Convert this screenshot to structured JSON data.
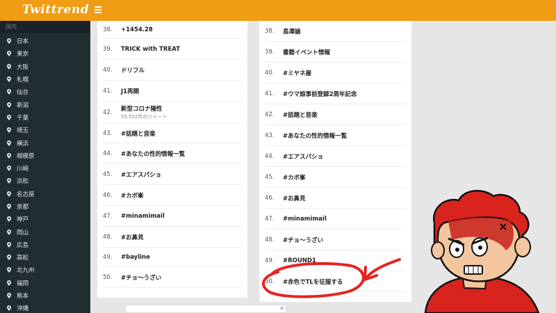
{
  "header": {
    "logo": "Twittrend",
    "menu_icon": "hamburger-icon",
    "accent": "#f09c14"
  },
  "sidebar": {
    "header": "国内",
    "items": [
      "日本",
      "東京",
      "大阪",
      "札幌",
      "仙台",
      "新潟",
      "千葉",
      "埼玉",
      "横浜",
      "相模原",
      "川崎",
      "浜松",
      "名古屋",
      "京都",
      "神戸",
      "岡山",
      "広島",
      "高松",
      "北九州",
      "福岡",
      "熊本",
      "沖縄"
    ]
  },
  "left_list": [
    {
      "rank": "38.",
      "topic": "+1454.28"
    },
    {
      "rank": "39.",
      "topic": "TRICK with TREAT"
    },
    {
      "rank": "40.",
      "topic": "ドリフル"
    },
    {
      "rank": "41.",
      "topic": "J1再開"
    },
    {
      "rank": "42.",
      "topic": "新型コロナ陽性",
      "sub": "55,552件のツイート"
    },
    {
      "rank": "43.",
      "topic": "#話題と音楽"
    },
    {
      "rank": "44.",
      "topic": "#あなたの性的情報一覧"
    },
    {
      "rank": "45.",
      "topic": "#エアスパショ"
    },
    {
      "rank": "46.",
      "topic": "#カボ峯"
    },
    {
      "rank": "47.",
      "topic": "#minamimail"
    },
    {
      "rank": "48.",
      "topic": "#お鼻見"
    },
    {
      "rank": "49.",
      "topic": "#bayline"
    },
    {
      "rank": "50.",
      "topic": "#チョ〜うざい"
    }
  ],
  "right_list": [
    {
      "rank": "38.",
      "topic": "島澤諭"
    },
    {
      "rank": "39.",
      "topic": "書籍イベント情報"
    },
    {
      "rank": "40.",
      "topic": "#ミヤネ屋"
    },
    {
      "rank": "41.",
      "topic": "#ウマ娘事前登録2周年記念"
    },
    {
      "rank": "42.",
      "topic": "#話題と音楽"
    },
    {
      "rank": "43.",
      "topic": "#あなたの性的情報一覧"
    },
    {
      "rank": "44.",
      "topic": "#エアスパショ"
    },
    {
      "rank": "45.",
      "topic": "#カボ峯"
    },
    {
      "rank": "46.",
      "topic": "#お鼻見"
    },
    {
      "rank": "47.",
      "topic": "#minamimail"
    },
    {
      "rank": "48.",
      "topic": "#チョ〜うざい"
    },
    {
      "rank": "49.",
      "topic": "#ROUND1"
    },
    {
      "rank": "50.",
      "topic": "#赤色でTLを征服する"
    }
  ],
  "ad": {
    "close": "✕"
  },
  "colors": {
    "annotation_red": "#e8231f",
    "sidebar_bg": "#222d32"
  }
}
